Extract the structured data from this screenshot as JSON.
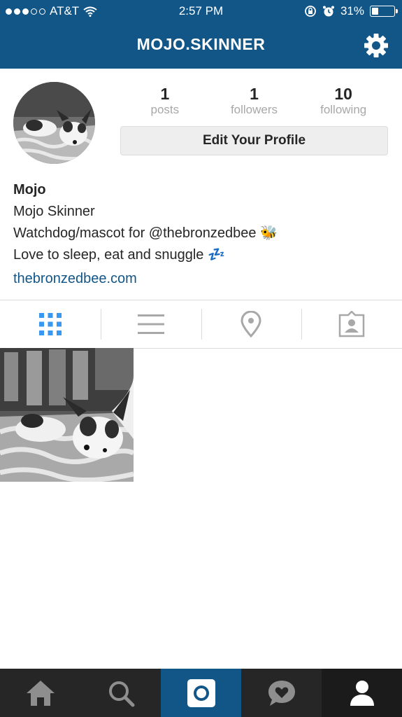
{
  "status_bar": {
    "carrier": "AT&T",
    "time": "2:57 PM",
    "battery_percent": "31%",
    "battery_level": 0.31,
    "signal_strength": 3
  },
  "header": {
    "title": "MOJO.SKINNER",
    "settings_icon": "gear-icon",
    "background": "#125688"
  },
  "stats": [
    {
      "value": "1",
      "label": "posts"
    },
    {
      "value": "1",
      "label": "followers"
    },
    {
      "value": "10",
      "label": "following"
    }
  ],
  "edit_profile_label": "Edit Your Profile",
  "bio": {
    "username": "Mojo",
    "full_name": "Mojo Skinner",
    "line1": "Watchdog/mascot for @thebronzedbee 🐝",
    "line2": "Love to sleep, eat and snuggle 💤",
    "website": "thebronzedbee.com"
  },
  "view_tabs": [
    {
      "icon": "grid-icon",
      "active": true
    },
    {
      "icon": "list-icon",
      "active": false
    },
    {
      "icon": "location-pin-icon",
      "active": false
    },
    {
      "icon": "tagged-photos-icon",
      "active": false
    }
  ],
  "bottom_nav": [
    {
      "icon": "home-icon"
    },
    {
      "icon": "search-icon"
    },
    {
      "icon": "camera-icon"
    },
    {
      "icon": "activity-icon"
    },
    {
      "icon": "profile-icon"
    }
  ],
  "colors": {
    "accent": "#125688",
    "active_tab": "#3897f0",
    "inactive_icon": "#a8a8a8",
    "nav_bar": "#262626"
  }
}
